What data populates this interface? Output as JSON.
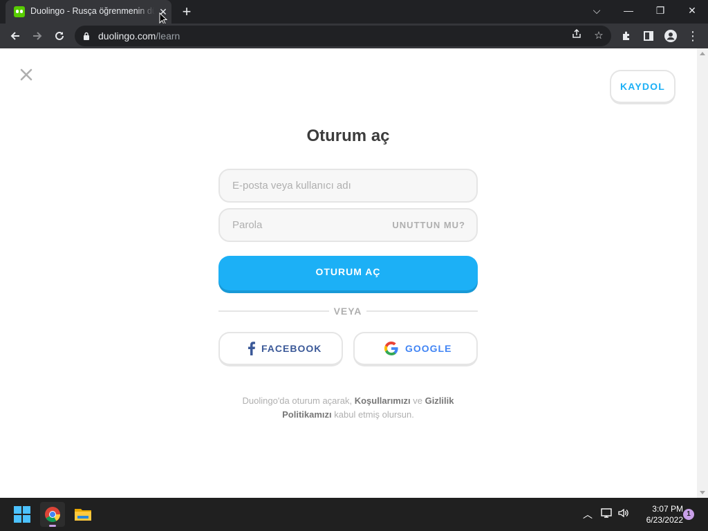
{
  "browser": {
    "tab_title": "Duolingo - Rusça öğrenmenin dünyadaki en iyi yolu",
    "tab_close": "✕",
    "new_tab": "+",
    "url_domain": "duolingo.com",
    "url_path": "/learn",
    "window_controls": {
      "dropdown": "⌵",
      "minimize": "—",
      "restore": "❐",
      "close": "✕"
    }
  },
  "page": {
    "signup_label": "KAYDOL",
    "title": "Oturum aç",
    "email_placeholder": "E-posta veya kullanıcı adı",
    "password_placeholder": "Parola",
    "forgot_label": "UNUTTUN MU?",
    "login_label": "OTURUM AÇ",
    "or_label": "VEYA",
    "facebook_label": "FACEBOOK",
    "google_label": "GOOGLE",
    "terms": {
      "part1": "Duolingo'da oturum açarak, ",
      "link1": "Koşullarımızı",
      "part2": " ve ",
      "link2": "Gizlilik Politikamızı",
      "part3": " kabul etmiş olursun."
    }
  },
  "colors": {
    "accent": "#1cb0f6",
    "facebook": "#3b5998",
    "google_text": "#4285f4"
  },
  "taskbar": {
    "time": "3:07 PM",
    "date": "6/23/2022",
    "notification_count": "1"
  }
}
